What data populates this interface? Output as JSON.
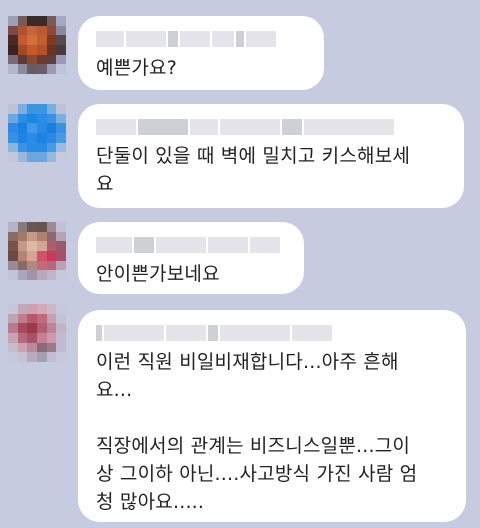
{
  "comments": [
    {
      "text": "예쁜가요?",
      "avatar_colors": [
        "#9aa0b8",
        "#7a5a58",
        "#3a2a2a",
        "#3a2a2a",
        "#7a5a58",
        "#a6a8c0",
        "#7a4a44",
        "#b0502e",
        "#c4643a",
        "#b85a34",
        "#8c4a3a",
        "#8a8aa4",
        "#4a2a24",
        "#c45a2c",
        "#d0703e",
        "#c25e30",
        "#7a3a26",
        "#5a4a50",
        "#3a2420",
        "#a24a28",
        "#c25a2e",
        "#b0522a",
        "#6a3424",
        "#4a3a40",
        "#7a6a78",
        "#5a3a34",
        "#8a4a30",
        "#6a3a2c",
        "#5a3e40",
        "#9a9ab4",
        "#b4b8cc",
        "#8a8aa0",
        "#6a5a66",
        "#6a5c6a",
        "#9a9ab2",
        "#c0c4da"
      ]
    },
    {
      "text": "단둘이 있을 때 벽에 밀치고 키스해보세\n요",
      "avatar_colors": [
        "#bcc2d8",
        "#7aaede",
        "#3a96e0",
        "#3a96e0",
        "#7aaede",
        "#bcc2d8",
        "#6aa8e0",
        "#2a8ee6",
        "#1a86e6",
        "#2a8ce6",
        "#3a92e2",
        "#7ab0de",
        "#2e8ae6",
        "#1a80e2",
        "#3e9ae8",
        "#2a8ae6",
        "#1a7ede",
        "#3a92e2",
        "#3690e6",
        "#1e84e4",
        "#2a8ae6",
        "#1e82e2",
        "#2a88e4",
        "#4a9ae2",
        "#8ab6de",
        "#3a92e4",
        "#2a8ae6",
        "#2a8ae6",
        "#4a9ae2",
        "#9abce0",
        "#c2c6dc",
        "#9ab8dc",
        "#6aa6e0",
        "#6aa6e0",
        "#9ab8dc",
        "#c6cade"
      ]
    },
    {
      "text": "안이쁜가보네요",
      "avatar_colors": [
        "#b4b2c8",
        "#8a7a7e",
        "#6a5652",
        "#6a5450",
        "#9a8a92",
        "#c0c2d6",
        "#8a6a64",
        "#a07a6a",
        "#c49a88",
        "#b08070",
        "#8a6a70",
        "#b2a4b4",
        "#7a5248",
        "#c69888",
        "#e0b8a8",
        "#d4a494",
        "#b45a6a",
        "#9a5a6c",
        "#6a4a44",
        "#b48474",
        "#d6a494",
        "#d2506a",
        "#c83a5a",
        "#a8506a",
        "#9a8a96",
        "#8a6a62",
        "#b08a80",
        "#c26a7a",
        "#b4687e",
        "#b8a4b6",
        "#c2c4d8",
        "#aaa6bc",
        "#a094a6",
        "#b8a8ba",
        "#c0b6c8",
        "#c6c8dc"
      ]
    },
    {
      "text": "이런 직원 비일비재합니다...아주 흔해\n요...\n\n직장에서의 관계는 비즈니스일뿐...그이\n상 그이하 아닌....사고방식 가진 사람 엄\n청 많아요.....",
      "avatar_colors": [
        "#c4c6da",
        "#c0a8b8",
        "#d0a0b0",
        "#d4a8b6",
        "#c8b8c8",
        "#c6c8dc",
        "#c0a4b4",
        "#c47a8e",
        "#b8586c",
        "#c26a7c",
        "#c4a0b0",
        "#c4c2d6",
        "#b87a8a",
        "#a84a5c",
        "#9a3a4c",
        "#b06070",
        "#bc8494",
        "#c0b4c6",
        "#c6a4b4",
        "#b4687a",
        "#a85468",
        "#c08294",
        "#cc9aac",
        "#c2bace",
        "#c4bccc",
        "#c8a4b4",
        "#ba8a9c",
        "#8a6a78",
        "#9a7a8a",
        "#c0bcce",
        "#c6c8dc",
        "#c4c2d4",
        "#b8acbc",
        "#a4a0b4",
        "#c0bed0",
        "#c6c8dc"
      ]
    }
  ]
}
